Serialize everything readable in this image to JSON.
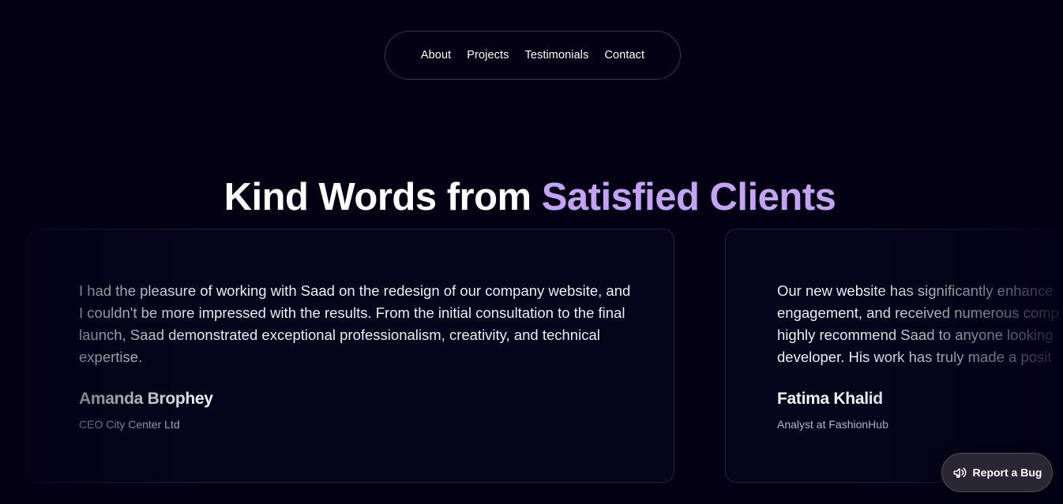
{
  "nav": {
    "items": [
      {
        "label": "About"
      },
      {
        "label": "Projects"
      },
      {
        "label": "Testimonials"
      },
      {
        "label": "Contact"
      }
    ]
  },
  "heading": {
    "prefix": "Kind Words from ",
    "accent": "Satisfied Clients",
    "accent_color": "#c4a3f5"
  },
  "testimonials": [
    {
      "quote": "I had the pleasure of working with Saad on the redesign of our company website, and I couldn't be more impressed with the results. From the initial consultation to the final launch, Saad demonstrated exceptional professionalism, creativity, and technical expertise.",
      "name": "Amanda Brophey",
      "role": "CEO City Center Ltd"
    },
    {
      "quote_lines": [
        "Our new website has significantly enhance",
        "engagement, and received numerous comp",
        "highly recommend Saad to anyone looking",
        "developer. His work has truly made a posit"
      ],
      "name": "Fatima Khalid",
      "role": "Analyst at FashionHub"
    }
  ],
  "bug_button": {
    "label": "Report a Bug",
    "icon": "megaphone-icon"
  },
  "colors": {
    "background": "#030014",
    "accent": "#c4a3f5"
  }
}
